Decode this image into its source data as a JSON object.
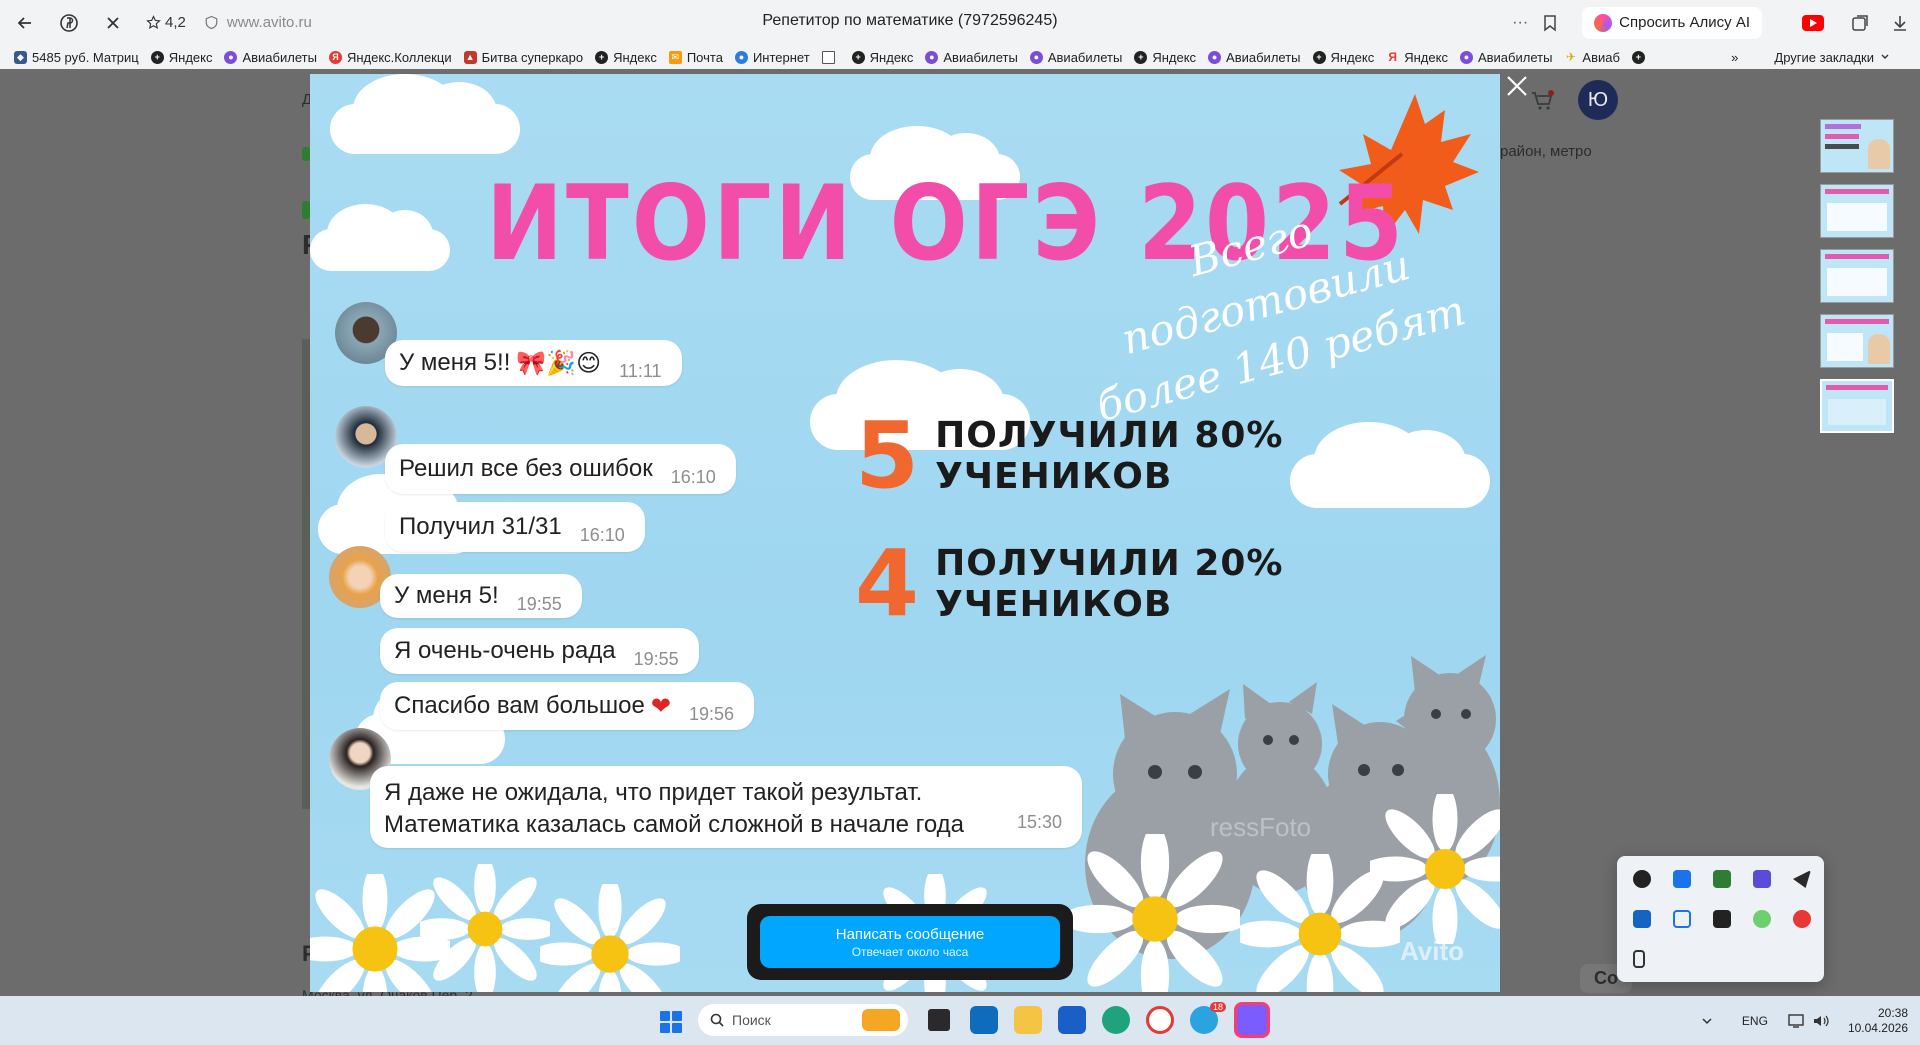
{
  "browser": {
    "rating": "4,2",
    "url": "www.avito.ru",
    "title": "Репетитор по математике (7972596245)",
    "alice_label": "Спросить Алису AI",
    "more_glyph": "···"
  },
  "bookmarks": {
    "items": [
      {
        "label": "5485 руб. Матриц",
        "icon": "shield-icon",
        "color": "#3a5a8a"
      },
      {
        "label": "Яндекс",
        "icon": "plus-icon",
        "color": "#222222"
      },
      {
        "label": "Авиабилеты",
        "icon": "globe-icon",
        "color": "#7b4dd8"
      },
      {
        "label": "Яндекс.Коллекци",
        "icon": "yandex-icon",
        "color": "#e53935"
      },
      {
        "label": "Битва суперкаро",
        "icon": "game-icon",
        "color": "#c0392b"
      },
      {
        "label": "Яндекс",
        "icon": "plus-icon",
        "color": "#222222"
      },
      {
        "label": "Почта",
        "icon": "mail-icon",
        "color": "#f39c12"
      },
      {
        "label": "Интернет",
        "icon": "globe-icon",
        "color": "#2c7be5"
      },
      {
        "label": "",
        "icon": "doc-icon",
        "color": "#555555"
      },
      {
        "label": "Яндекс",
        "icon": "plus-icon",
        "color": "#222222"
      },
      {
        "label": "Авиабилеты",
        "icon": "globe-icon",
        "color": "#7b4dd8"
      },
      {
        "label": "Авиабилеты",
        "icon": "globe-icon",
        "color": "#7b4dd8"
      },
      {
        "label": "Яндекс",
        "icon": "plus-icon",
        "color": "#222222"
      },
      {
        "label": "Авиабилеты",
        "icon": "globe-icon",
        "color": "#7b4dd8"
      },
      {
        "label": "Яндекс",
        "icon": "plus-icon",
        "color": "#222222"
      },
      {
        "label": "Яндекс",
        "icon": "yandex-icon",
        "color": "#e53935"
      },
      {
        "label": "Авиабилеты",
        "icon": "globe-icon",
        "color": "#7b4dd8"
      },
      {
        "label": "Авиаб",
        "icon": "plane-icon",
        "color": "#f1c40f"
      },
      {
        "label": "",
        "icon": "plus-icon",
        "color": "#222222"
      }
    ],
    "more_label": "Другие закладки",
    "chevron_glyph": "»"
  },
  "page": {
    "avatar_letter": "Ю",
    "bg_fragment_1": "Д",
    "bg_fragment_2": "район, метро",
    "bg_fragment_3": "Р",
    "bg_fragment_4": "Москва, ул. Очаков Пер. 2",
    "bg_fragment_5": "Со"
  },
  "slide": {
    "headline": "ИТОГИ ОГЭ 2025",
    "script_line1": "Всего подготовили",
    "script_line2": "более 140 ребят",
    "stats": [
      {
        "num": "5",
        "text": "ПОЛУЧИЛИ 80% УЧЕНИКОВ"
      },
      {
        "num": "4",
        "text": "ПОЛУЧИЛИ 20% УЧЕНИКОВ"
      }
    ],
    "messages": [
      {
        "text": "У меня 5!!",
        "emoji": "🎀🎉😊",
        "time": "11:11"
      },
      {
        "text": "Решил все без ошибок",
        "time": "16:10"
      },
      {
        "text": "Получил 31/31",
        "time": "16:10"
      },
      {
        "text": "У меня 5!",
        "time": "19:55"
      },
      {
        "text": "Я очень-очень рада",
        "time": "19:55"
      },
      {
        "text": "Спасибо вам большое",
        "emoji": "❤",
        "time": "19:56"
      },
      {
        "line1": "Я даже не ожидала, что придет такой результат.",
        "line2": "Математика казалась самой сложной в начале года",
        "time": "15:30"
      }
    ],
    "watermark": "Avito",
    "watermark2": "ressFoto"
  },
  "contact": {
    "label": "Написать сообщение",
    "sub": "Отвечает около часа"
  },
  "taskbar": {
    "search_placeholder": "Поиск",
    "telegram_badge": "18",
    "lang": "ENG",
    "time": "20:38",
    "date": "10.04.2026"
  }
}
